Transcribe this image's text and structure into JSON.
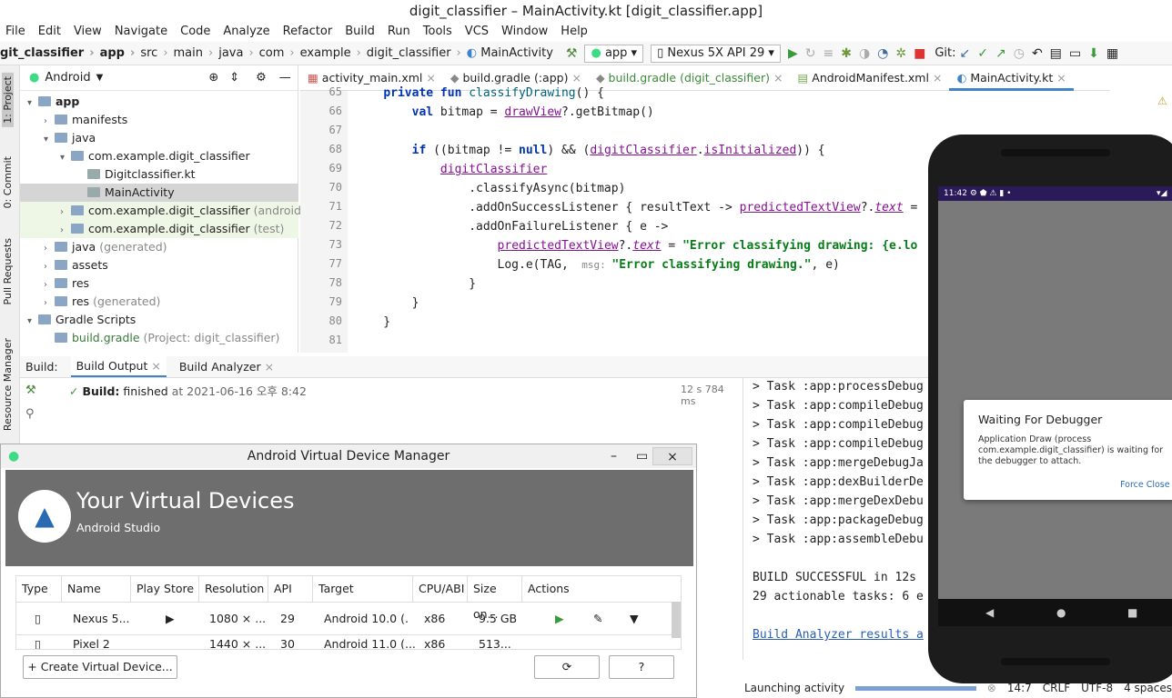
{
  "window_title": "digit_classifier – MainActivity.kt [digit_classifier.app]",
  "menu": [
    "File",
    "Edit",
    "View",
    "Navigate",
    "Code",
    "Analyze",
    "Refactor",
    "Build",
    "Run",
    "Tools",
    "VCS",
    "Window",
    "Help"
  ],
  "breadcrumb": [
    "git_classifier",
    "app",
    "src",
    "main",
    "java",
    "com",
    "example",
    "digit_classifier",
    "MainActivity"
  ],
  "toolbar": {
    "config": "app",
    "device": "Nexus 5X API 29",
    "git_label": "Git:"
  },
  "left_tabs": [
    "1: Project",
    "0: Commit",
    "Pull Requests",
    "Resource Manager"
  ],
  "project": {
    "view_label": "Android",
    "tree": [
      {
        "label": "app",
        "level": 0,
        "bold": true
      },
      {
        "label": "manifests",
        "level": 1
      },
      {
        "label": "java",
        "level": 1
      },
      {
        "label": "com.example.digit_classifier",
        "level": 2
      },
      {
        "label": "Digitclassifier.kt",
        "level": 3
      },
      {
        "label": "MainActivity",
        "level": 3
      },
      {
        "label": "com.example.digit_classifier",
        "suffix": "(androidTest)",
        "level": 2
      },
      {
        "label": "com.example.digit_classifier",
        "suffix": "(test)",
        "level": 2
      },
      {
        "label": "java",
        "suffix": "(generated)",
        "level": 1
      },
      {
        "label": "assets",
        "level": 1
      },
      {
        "label": "res",
        "level": 1
      },
      {
        "label": "res",
        "suffix": "(generated)",
        "level": 1
      },
      {
        "label": "Gradle Scripts",
        "level": 0
      },
      {
        "label": "build.gradle",
        "suffix": "(Project: digit_classifier)",
        "level": 1
      }
    ]
  },
  "editor_tabs": [
    "activity_main.xml",
    "build.gradle (:app)",
    "build.gradle (digit_classifier)",
    "AndroidManifest.xml",
    "MainActivity.kt"
  ],
  "code": {
    "line_numbers": [
      "65",
      "66",
      "67",
      "68",
      "69",
      "70",
      "71",
      "72",
      "73",
      "77",
      "78",
      "79",
      "80",
      "81"
    ]
  },
  "build": {
    "label": "Build:",
    "tabs": [
      "Build Output",
      "Build Analyzer"
    ],
    "status_bold": "Build:",
    "status_text": "finished",
    "status_time": "at 2021-06-16 오후 8:42",
    "duration": "12 s 784 ms",
    "console": [
      "> Task :app:processDebug",
      "> Task :app:compileDebug",
      "> Task :app:compileDebug",
      "> Task :app:compileDebug",
      "> Task :app:mergeDebugJa",
      "> Task :app:dexBuilderDe",
      "> Task :app:mergeDexDebu",
      "> Task :app:packageDebug",
      "> Task :app:assembleDebu",
      "",
      "BUILD SUCCESSFUL in 12s",
      "29 actionable tasks: 6 e",
      "",
      "Build Analyzer results a"
    ]
  },
  "status": {
    "activity": "Launching activity",
    "position": "14:7",
    "eol": "CRLF",
    "encoding": "UTF-8",
    "indent": "4 spaces"
  },
  "avd": {
    "title": "Android Virtual Device Manager",
    "heading": "Your Virtual Devices",
    "subheading": "Android Studio",
    "columns": [
      "Type",
      "Name",
      "Play Store",
      "Resolution",
      "API",
      "Target",
      "CPU/ABI",
      "Size on...",
      "Actions"
    ],
    "rows": [
      {
        "name": "Nexus 5...",
        "resolution": "1080 × ...",
        "api": "29",
        "target": "Android 10.0 (...",
        "cpu": "x86",
        "size": "9.5 GB"
      },
      {
        "name": "Pixel 2",
        "resolution": "1440 × ...",
        "api": "30",
        "target": "Android 11.0 (...",
        "cpu": "x86",
        "size": "513..."
      }
    ],
    "create_button": "Create Virtual Device...",
    "help_button": "?"
  },
  "phone": {
    "time": "11:42",
    "dialog_title": "Waiting For Debugger",
    "dialog_body": "Application Draw (process com.example.digit_classifier) is waiting for the debugger to attach.",
    "dialog_button": "Force Close"
  }
}
